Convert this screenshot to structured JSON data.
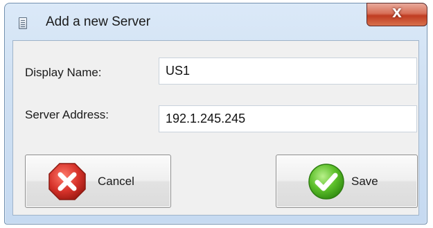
{
  "window": {
    "title": "Add a new Server",
    "close_label": "X"
  },
  "form": {
    "display_name": {
      "label": "Display Name:",
      "value": "US1"
    },
    "server_address": {
      "label": "Server Address:",
      "value": "192.1.245.245"
    }
  },
  "buttons": {
    "cancel": {
      "label": "Cancel",
      "icon": "red-x-octagon-icon"
    },
    "save": {
      "label": "Save",
      "icon": "green-checkmark-icon"
    }
  },
  "colors": {
    "titlebar": "#cfe0f3",
    "close_button": "#c8432a",
    "client_area": "#f0f0f0",
    "cancel_icon": "#d6322a",
    "save_icon": "#3ea51e"
  }
}
